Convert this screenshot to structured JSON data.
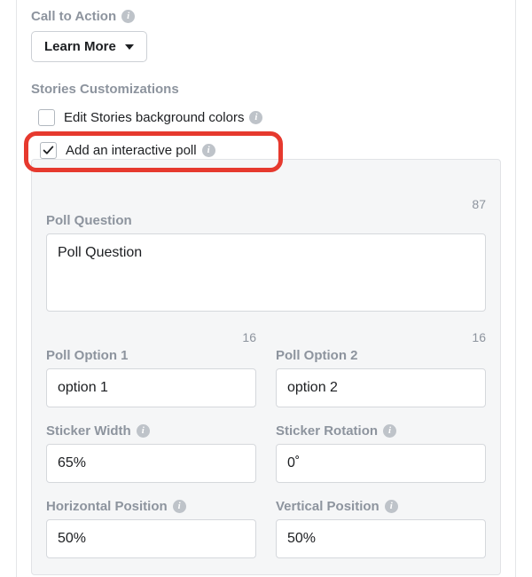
{
  "cta": {
    "label": "Call to Action",
    "button": "Learn More"
  },
  "stories": {
    "title": "Stories Customizations",
    "edit_bg_label": "Edit Stories background colors",
    "edit_bg_checked": false,
    "add_poll_label": "Add an interactive poll",
    "add_poll_checked": true
  },
  "poll": {
    "question_label": "Poll Question",
    "question_counter": "87",
    "question_value": "Poll Question",
    "option1_label": "Poll Option 1",
    "option1_counter": "16",
    "option1_value": "option 1",
    "option2_label": "Poll Option 2",
    "option2_counter": "16",
    "option2_value": "option 2",
    "width_label": "Sticker Width",
    "width_value": "65%",
    "rotation_label": "Sticker Rotation",
    "rotation_value": "0˚",
    "hpos_label": "Horizontal Position",
    "hpos_value": "50%",
    "vpos_label": "Vertical Position",
    "vpos_value": "50%"
  }
}
